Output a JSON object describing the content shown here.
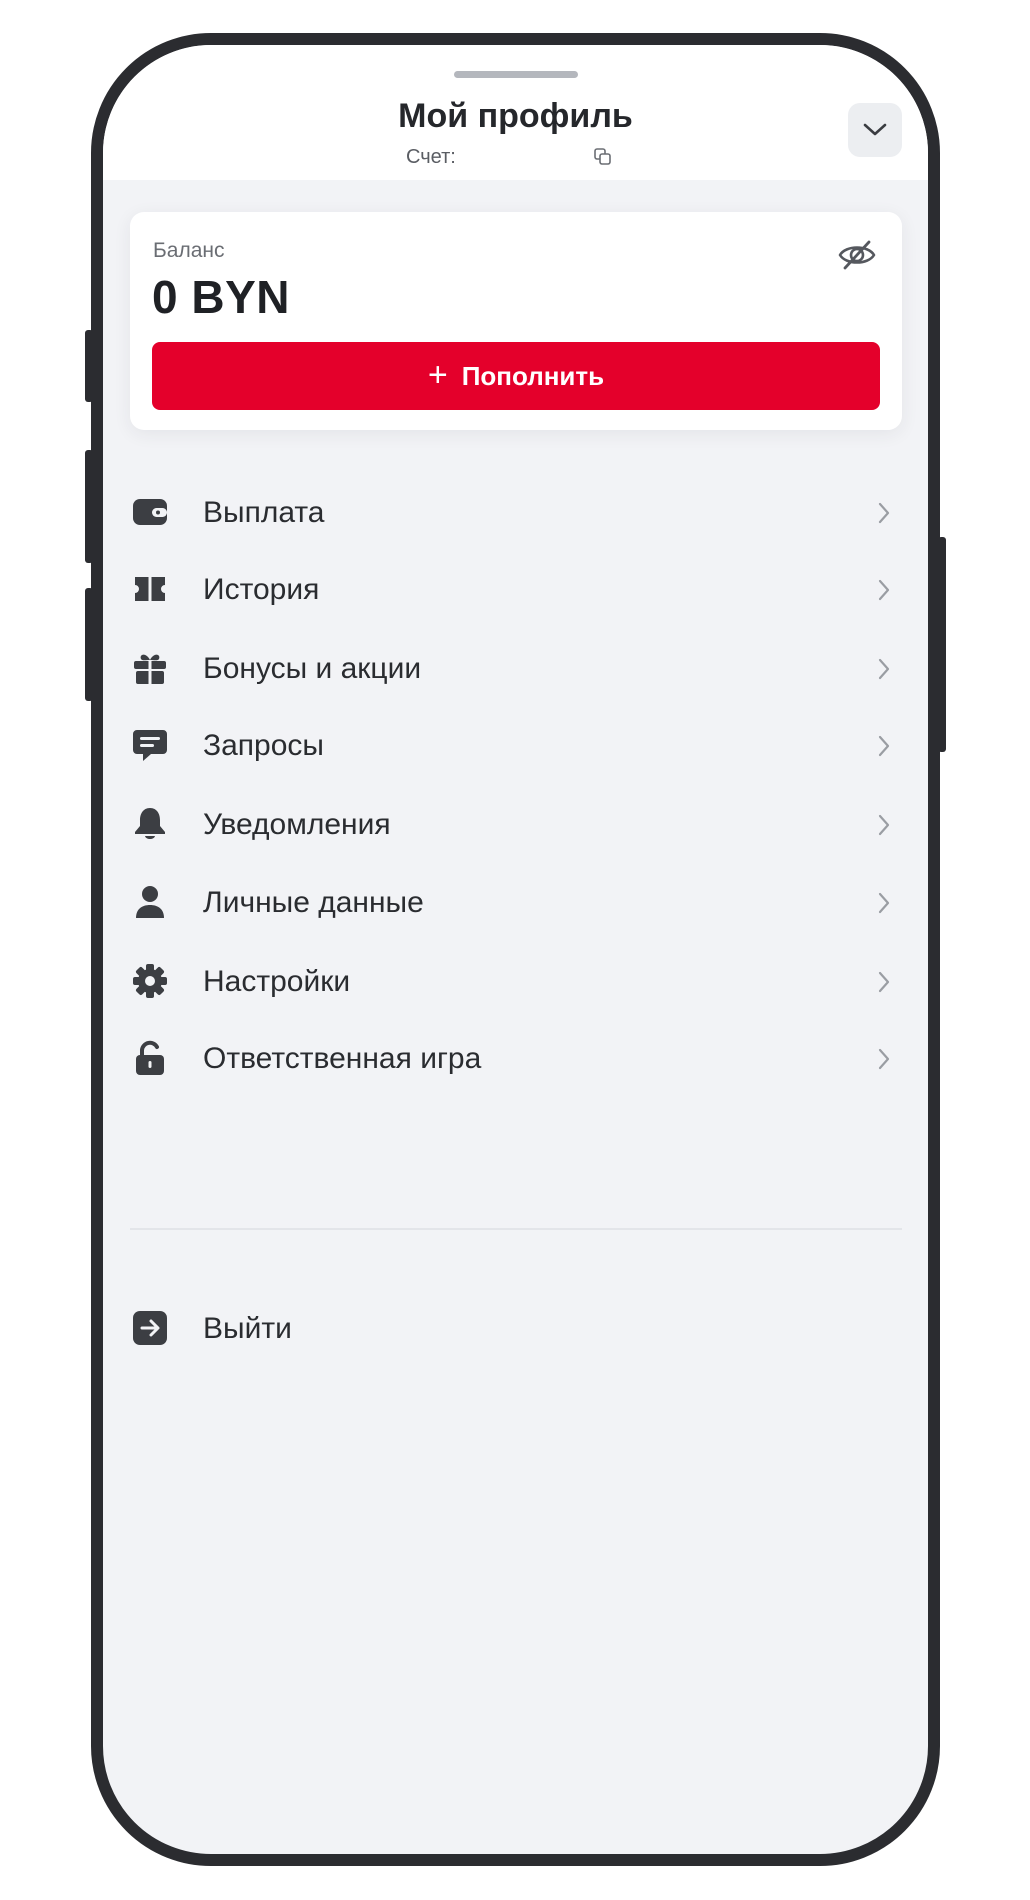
{
  "header": {
    "title": "Мой профиль",
    "account_label": "Счет:"
  },
  "balance": {
    "label": "Баланс",
    "value": "0 BYN",
    "topup_label": "Пополнить"
  },
  "menu": {
    "items": [
      {
        "label": "Выплата",
        "icon": "wallet-icon"
      },
      {
        "label": "История",
        "icon": "ticket-icon"
      },
      {
        "label": "Бонусы и акции",
        "icon": "gift-icon"
      },
      {
        "label": "Запросы",
        "icon": "chat-icon"
      },
      {
        "label": "Уведомления",
        "icon": "bell-icon"
      },
      {
        "label": "Личные данные",
        "icon": "user-icon"
      },
      {
        "label": "Настройки",
        "icon": "gear-icon"
      },
      {
        "label": "Ответственная игра",
        "icon": "lock-icon"
      }
    ],
    "logout_label": "Выйти"
  },
  "colors": {
    "accent": "#e4002b",
    "background": "#f2f3f6",
    "text": "#2a2c30",
    "frame": "#2b2c30"
  }
}
